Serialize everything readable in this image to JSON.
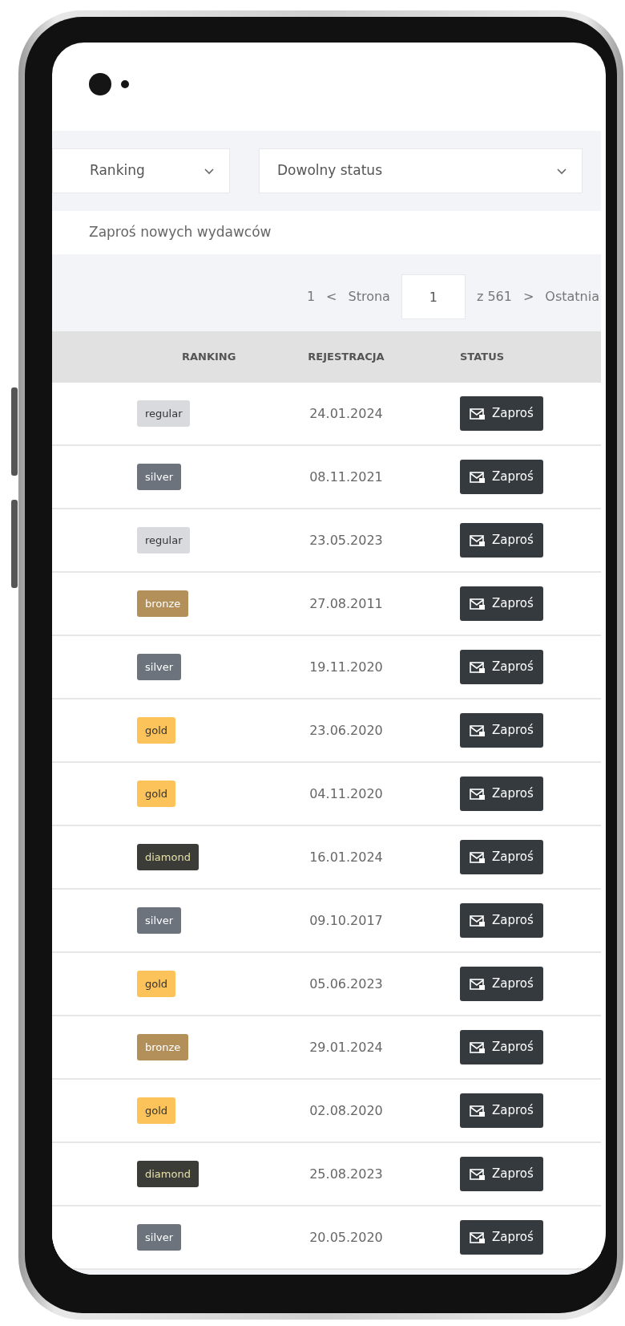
{
  "filters": [
    {
      "value": "Ranking"
    },
    {
      "value": "Dowolny status"
    }
  ],
  "invite_link": "Zaproś nowych wydawców",
  "pagination": {
    "first": "1",
    "prev": "<",
    "page_label": "Strona",
    "page_value": "1",
    "total": "z 561",
    "next": ">",
    "last": "Ostatnia"
  },
  "table": {
    "columns": [
      "RANKING",
      "REJESTRACJA",
      "STATUS"
    ],
    "rows": [
      {
        "rank": {
          "label": "regular",
          "color": "#d9dade"
        },
        "date": "24.01.2024",
        "action": "Zaproś"
      },
      {
        "rank": {
          "label": "silver",
          "color": "#6c737d"
        },
        "date": "08.11.2021",
        "action": "Zaproś"
      },
      {
        "rank": {
          "label": "regular",
          "color": "#d9dade"
        },
        "date": "23.05.2023",
        "action": "Zaproś"
      },
      {
        "rank": {
          "label": "bronze",
          "color": "#b38f5a"
        },
        "date": "27.08.2011",
        "action": "Zaproś"
      },
      {
        "rank": {
          "label": "silver",
          "color": "#6c737d"
        },
        "date": "19.11.2020",
        "action": "Zaproś"
      },
      {
        "rank": {
          "label": "gold",
          "color": "#fcc35a"
        },
        "date": "23.06.2020",
        "action": "Zaproś"
      },
      {
        "rank": {
          "label": "gold",
          "color": "#fcc35a"
        },
        "date": "04.11.2020",
        "action": "Zaproś"
      },
      {
        "rank": {
          "label": "diamond",
          "color": "#3b3b38"
        },
        "date": "16.01.2024",
        "action": "Zaproś"
      },
      {
        "rank": {
          "label": "silver",
          "color": "#6c737d"
        },
        "date": "09.10.2017",
        "action": "Zaproś"
      },
      {
        "rank": {
          "label": "gold",
          "color": "#fcc35a"
        },
        "date": "05.06.2023",
        "action": "Zaproś"
      },
      {
        "rank": {
          "label": "bronze",
          "color": "#b38f5a"
        },
        "date": "29.01.2024",
        "action": "Zaproś"
      },
      {
        "rank": {
          "label": "gold",
          "color": "#fcc35a"
        },
        "date": "02.08.2020",
        "action": "Zaproś"
      },
      {
        "rank": {
          "label": "diamond",
          "color": "#3b3b38"
        },
        "date": "25.08.2023",
        "action": "Zaproś"
      },
      {
        "rank": {
          "label": "silver",
          "color": "#6c737d"
        },
        "date": "20.05.2020",
        "action": "Zaproś"
      }
    ]
  }
}
